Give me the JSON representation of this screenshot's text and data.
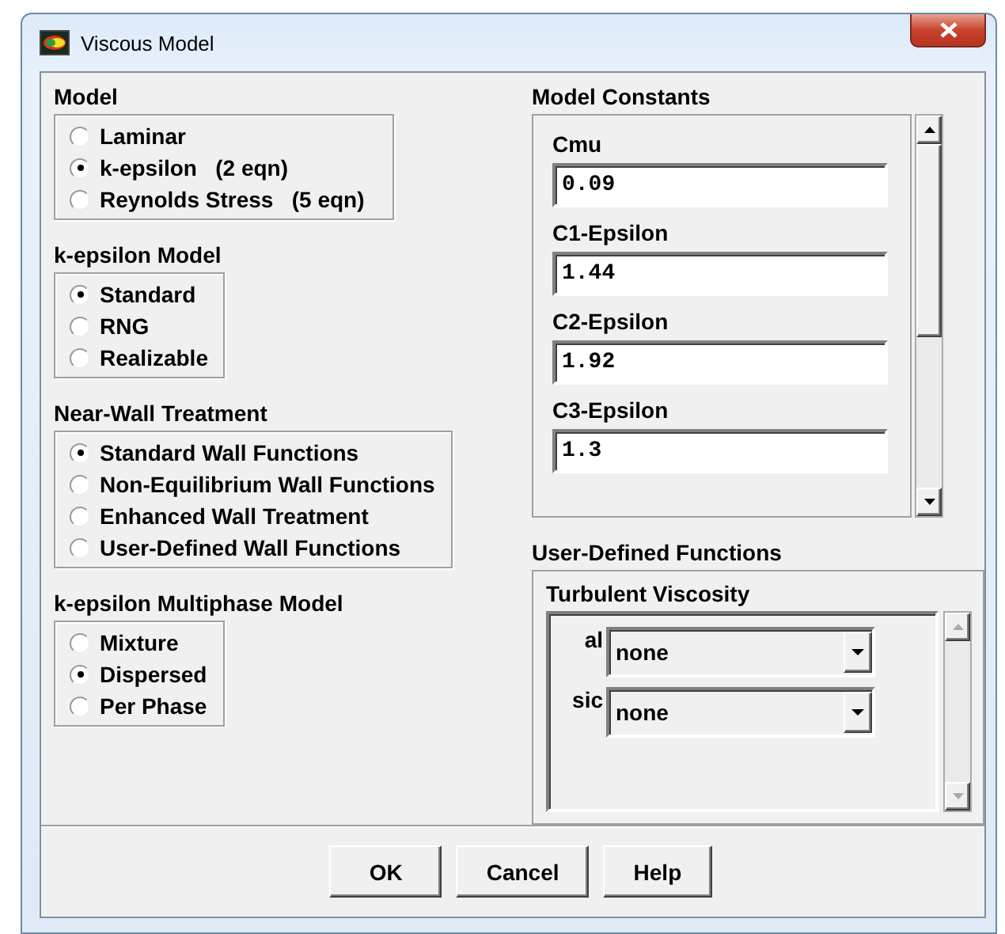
{
  "window": {
    "title": "Viscous Model"
  },
  "left_groups": [
    {
      "title": "Model",
      "options": [
        {
          "label": "Laminar",
          "selected": false
        },
        {
          "label": "k-epsilon   (2 eqn)",
          "selected": true
        },
        {
          "label": "Reynolds Stress   (5 eqn)",
          "selected": false
        }
      ]
    },
    {
      "title": "k-epsilon Model",
      "options": [
        {
          "label": "Standard",
          "selected": true
        },
        {
          "label": "RNG",
          "selected": false
        },
        {
          "label": "Realizable",
          "selected": false
        }
      ]
    },
    {
      "title": "Near-Wall Treatment",
      "options": [
        {
          "label": "Standard Wall Functions",
          "selected": true
        },
        {
          "label": "Non-Equilibrium Wall Functions",
          "selected": false
        },
        {
          "label": "Enhanced Wall Treatment",
          "selected": false
        },
        {
          "label": "User-Defined Wall Functions",
          "selected": false
        }
      ]
    },
    {
      "title": "k-epsilon Multiphase Model",
      "options": [
        {
          "label": "Mixture",
          "selected": false
        },
        {
          "label": "Dispersed",
          "selected": true
        },
        {
          "label": "Per Phase",
          "selected": false
        }
      ]
    }
  ],
  "model_constants": {
    "title": "Model Constants",
    "fields": [
      {
        "label": "Cmu",
        "value": "0.09"
      },
      {
        "label": "C1-Epsilon",
        "value": "1.44"
      },
      {
        "label": "C2-Epsilon",
        "value": "1.92"
      },
      {
        "label": "C3-Epsilon",
        "value": "1.3"
      }
    ]
  },
  "user_defined_functions": {
    "title": "User-Defined Functions",
    "subtitle": "Turbulent Viscosity",
    "rows": [
      {
        "label": "al",
        "value": "none"
      },
      {
        "label": "sic",
        "value": "none"
      }
    ]
  },
  "buttons": [
    "OK",
    "Cancel",
    "Help"
  ]
}
